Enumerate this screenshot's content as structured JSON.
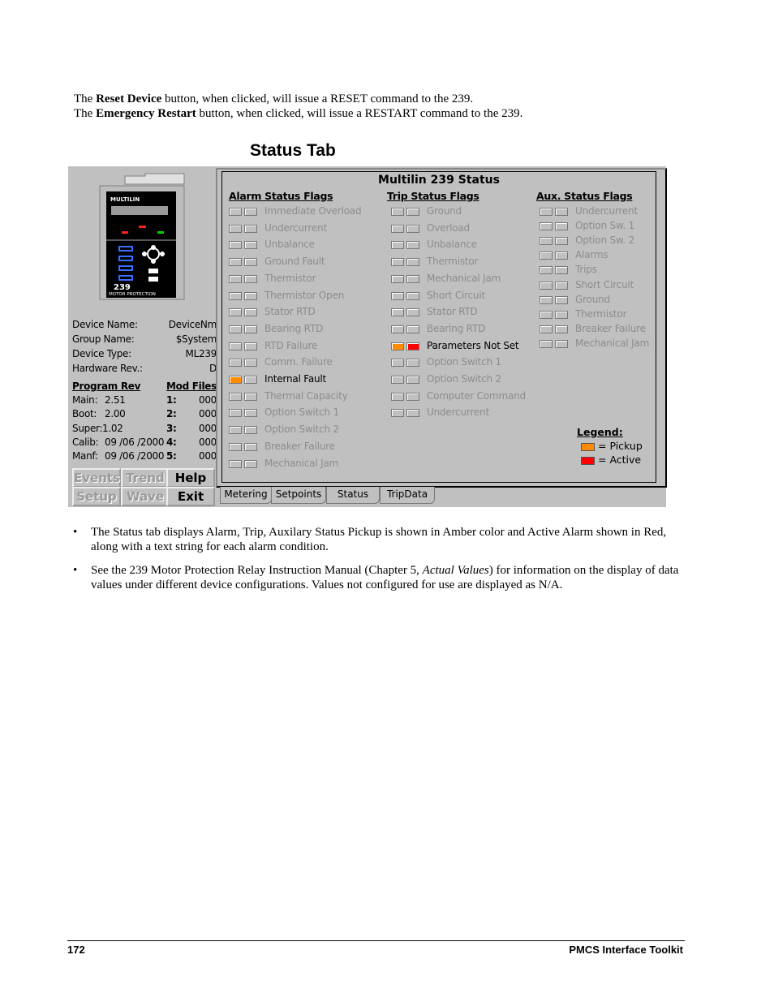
{
  "intro": [
    {
      "pre": "The ",
      "bold": "Reset Device",
      "post": " button, when clicked, will issue a RESET command to the 239."
    },
    {
      "pre": "The ",
      "bold": "Emergency Restart",
      "post": " button, when clicked, will issue a RESTART command to the 239."
    }
  ],
  "section_title": "Status Tab",
  "device_image": {
    "brand": "MULTILIN",
    "model": "239",
    "caption": "MOTOR PROTECTION"
  },
  "device_info": [
    {
      "label": "Device Name:",
      "value": "DeviceNm"
    },
    {
      "label": "Group Name:",
      "value": "$System"
    },
    {
      "label": "Device Type:",
      "value": "ML239"
    },
    {
      "label": "Hardware Rev.:",
      "value": "D"
    }
  ],
  "program_rev": {
    "header_left": "Program Rev",
    "header_right": "Mod Files",
    "rows": [
      {
        "label": "Main:",
        "value": "2.51",
        "mod": "1:",
        "mod_value": "000"
      },
      {
        "label": "Boot:",
        "value": "2.00",
        "mod": "2:",
        "mod_value": "000"
      },
      {
        "label": "Super:",
        "value": "1.02",
        "mod": "3:",
        "mod_value": "000"
      },
      {
        "label": "Calib:",
        "value": "09 /06 /2000",
        "mod": "4:",
        "mod_value": "000"
      },
      {
        "label": "Manf:",
        "value": "09 /06 /2000",
        "mod": "5:",
        "mod_value": "000"
      }
    ]
  },
  "buttons": [
    {
      "label": "Events",
      "enabled": false
    },
    {
      "label": "Trend",
      "enabled": false
    },
    {
      "label": "Help",
      "enabled": true
    },
    {
      "label": "Setup",
      "enabled": false
    },
    {
      "label": "Wave",
      "enabled": false
    },
    {
      "label": "Exit",
      "enabled": true
    }
  ],
  "panel_title": "Multilin 239 Status",
  "columns": [
    {
      "header": "Alarm Status Flags",
      "flags": [
        {
          "label": "Immediate Overload",
          "pickup": false,
          "active": false
        },
        {
          "label": "Undercurrent",
          "pickup": false,
          "active": false
        },
        {
          "label": "Unbalance",
          "pickup": false,
          "active": false
        },
        {
          "label": "Ground Fault",
          "pickup": false,
          "active": false
        },
        {
          "label": "Thermistor",
          "pickup": false,
          "active": false
        },
        {
          "label": "Thermistor Open",
          "pickup": false,
          "active": false
        },
        {
          "label": "Stator RTD",
          "pickup": false,
          "active": false
        },
        {
          "label": "Bearing RTD",
          "pickup": false,
          "active": false
        },
        {
          "label": "RTD Failure",
          "pickup": false,
          "active": false
        },
        {
          "label": "Comm. Failure",
          "pickup": false,
          "active": false
        },
        {
          "label": "Internal Fault",
          "pickup": true,
          "active": false
        },
        {
          "label": "Thermal Capacity",
          "pickup": false,
          "active": false
        },
        {
          "label": "Option Switch 1",
          "pickup": false,
          "active": false
        },
        {
          "label": "Option Switch 2",
          "pickup": false,
          "active": false
        },
        {
          "label": "Breaker Failure",
          "pickup": false,
          "active": false
        },
        {
          "label": "Mechanical Jam",
          "pickup": false,
          "active": false
        }
      ]
    },
    {
      "header": "Trip Status Flags",
      "flags": [
        {
          "label": "Ground",
          "pickup": false,
          "active": false
        },
        {
          "label": "Overload",
          "pickup": false,
          "active": false
        },
        {
          "label": "Unbalance",
          "pickup": false,
          "active": false
        },
        {
          "label": "Thermistor",
          "pickup": false,
          "active": false
        },
        {
          "label": "Mechanical Jam",
          "pickup": false,
          "active": false
        },
        {
          "label": "Short Circuit",
          "pickup": false,
          "active": false
        },
        {
          "label": "Stator RTD",
          "pickup": false,
          "active": false
        },
        {
          "label": "Bearing RTD",
          "pickup": false,
          "active": false
        },
        {
          "label": "Parameters Not Set",
          "pickup": true,
          "active": true
        },
        {
          "label": "Option Switch 1",
          "pickup": false,
          "active": false
        },
        {
          "label": "Option Switch 2",
          "pickup": false,
          "active": false
        },
        {
          "label": "Computer Command",
          "pickup": false,
          "active": false
        },
        {
          "label": "Undercurrent",
          "pickup": false,
          "active": false
        }
      ]
    },
    {
      "header": "Aux. Status Flags",
      "flags": [
        {
          "label": "Undercurrent",
          "pickup": false,
          "active": false
        },
        {
          "label": "Option Sw. 1",
          "pickup": false,
          "active": false
        },
        {
          "label": "Option Sw. 2",
          "pickup": false,
          "active": false
        },
        {
          "label": "Alarms",
          "pickup": false,
          "active": false
        },
        {
          "label": "Trips",
          "pickup": false,
          "active": false
        },
        {
          "label": "Short Circuit",
          "pickup": false,
          "active": false
        },
        {
          "label": "Ground",
          "pickup": false,
          "active": false
        },
        {
          "label": "Thermistor",
          "pickup": false,
          "active": false
        },
        {
          "label": "Breaker Failure",
          "pickup": false,
          "active": false
        },
        {
          "label": "Mechanical Jam",
          "pickup": false,
          "active": false
        }
      ]
    }
  ],
  "legend": {
    "title": "Legend:",
    "items": [
      {
        "label": "= Pickup",
        "color": "#ff8c00"
      },
      {
        "label": "= Active",
        "color": "#ff0000"
      }
    ]
  },
  "tabs": [
    "Metering",
    "Setpoints",
    "Status",
    "TripData"
  ],
  "selected_tab": "Status",
  "notes": [
    "The Status tab displays Alarm,  Trip, Auxilary Status Pickup is shown in  Amber color and Active Alarm shown in Red, along with a text string for each alarm condition.",
    {
      "pre": "See the 239 Motor Protection Relay Instruction Manual (Chapter 5, ",
      "italic": "Actual Values",
      "post": ") for information on the display of data values under different device configurations. Values not configured for use are displayed as N/A."
    }
  ],
  "footer": {
    "page": "172",
    "title": "PMCS Interface Toolkit"
  },
  "colors": {
    "pickup": "#ff8c00",
    "active": "#ff0000",
    "window_bg": "#c0c0c0",
    "disabled_text": "#8c8c8c"
  }
}
